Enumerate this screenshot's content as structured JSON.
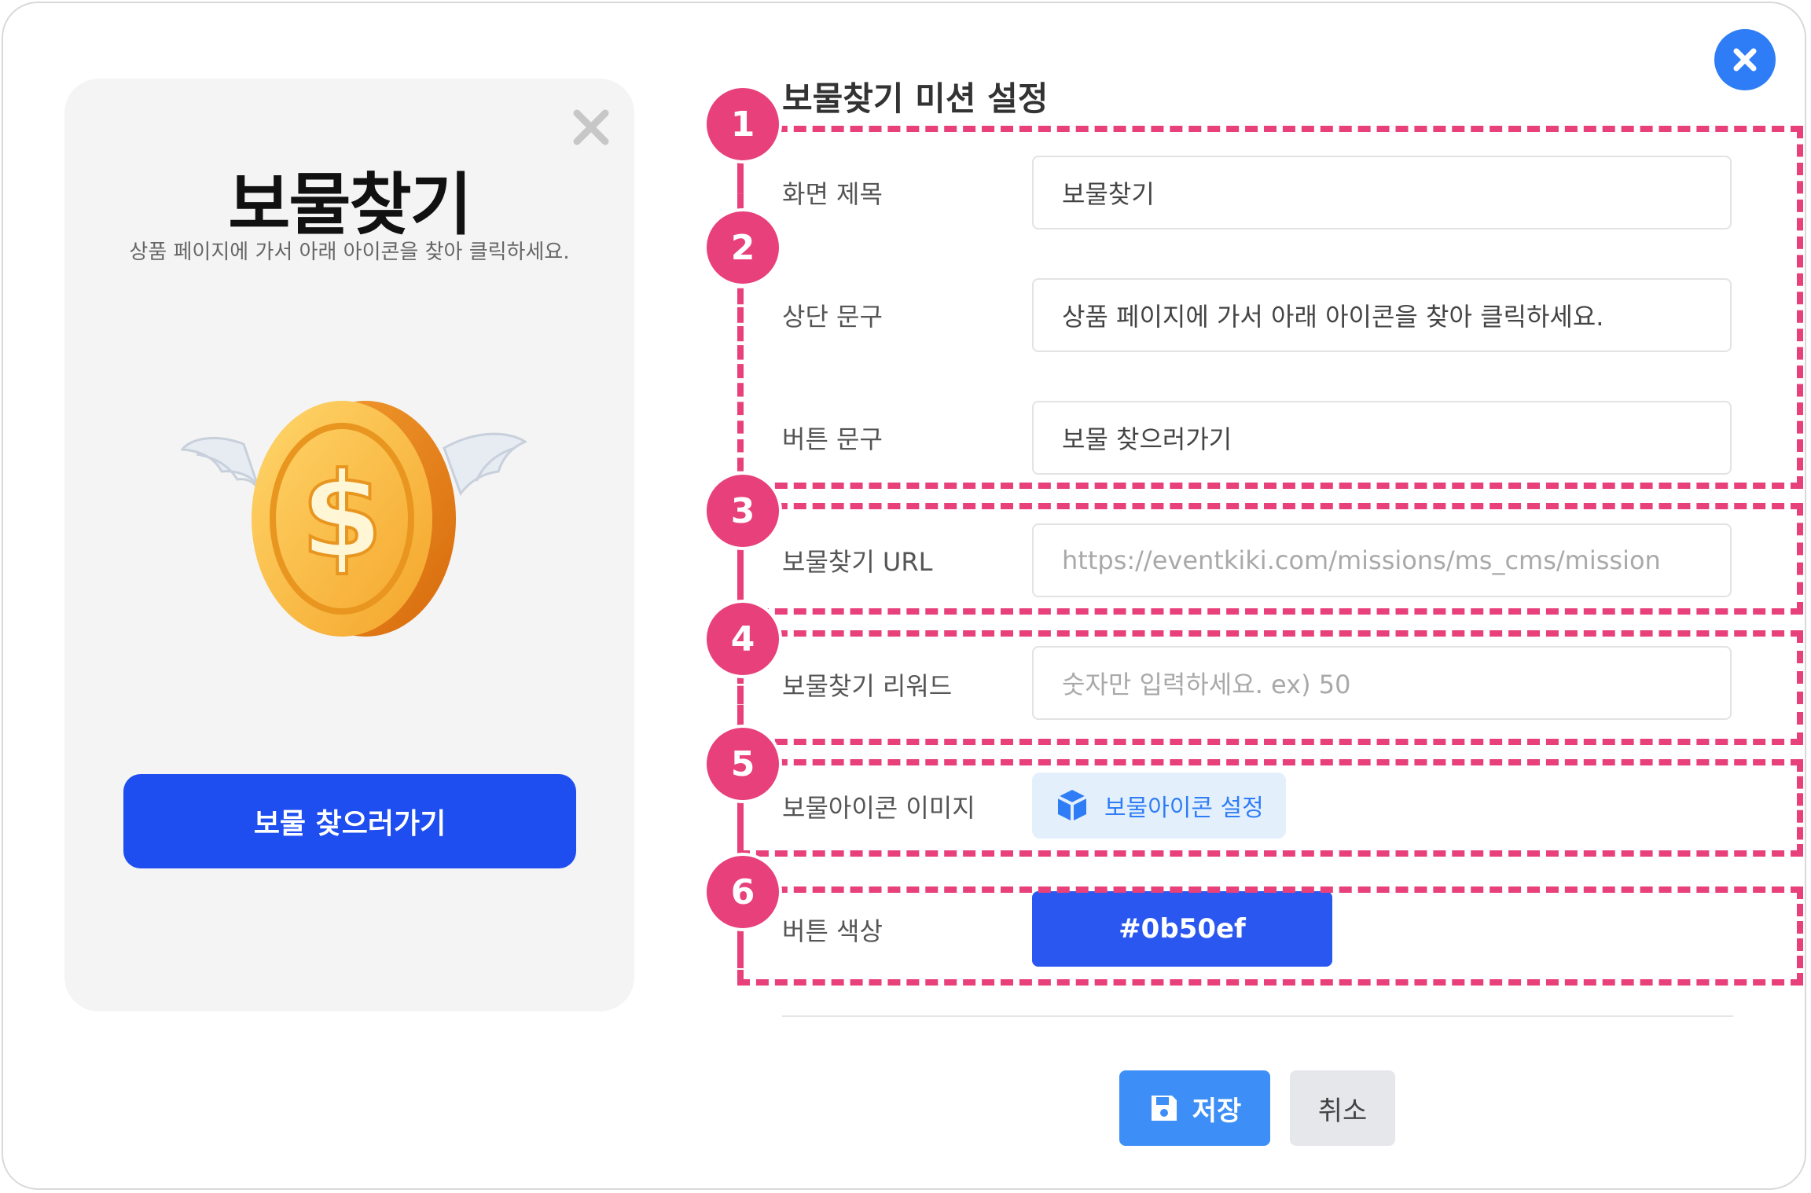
{
  "preview": {
    "title": "보물찾기",
    "subtitle": "상품 페이지에 가서 아래 아이콘을 찾아 클릭하세요.",
    "button_label": "보물 찾으러가기"
  },
  "settings": {
    "title": "보물찾기 미션 설정",
    "screen_title": {
      "label": "화면 제목",
      "value": "보물찾기"
    },
    "top_text": {
      "label": "상단 문구",
      "value": "상품 페이지에 가서 아래 아이콘을 찾아 클릭하세요."
    },
    "button_text": {
      "label": "버튼 문구",
      "value": "보물 찾으러가기"
    },
    "url": {
      "label": "보물찾기 URL",
      "placeholder": "https://eventkiki.com/missions/ms_cms/mission"
    },
    "reward": {
      "label": "보물찾기 리워드",
      "placeholder": "숫자만 입력하세요. ex) 50"
    },
    "icon_image": {
      "label": "보물아이콘 이미지",
      "button_label": "보물아이콘 설정"
    },
    "button_color": {
      "label": "버튼 색상",
      "value": "#0b50ef"
    }
  },
  "actions": {
    "save_label": "저장",
    "cancel_label": "취소"
  },
  "annotations": [
    "1",
    "2",
    "3",
    "4",
    "5",
    "6"
  ],
  "colors": {
    "primary": "#1f4ef0",
    "accent_blue": "#2f7df6",
    "annotation_pink": "#e8407a",
    "save_blue": "#3d8ff7"
  }
}
